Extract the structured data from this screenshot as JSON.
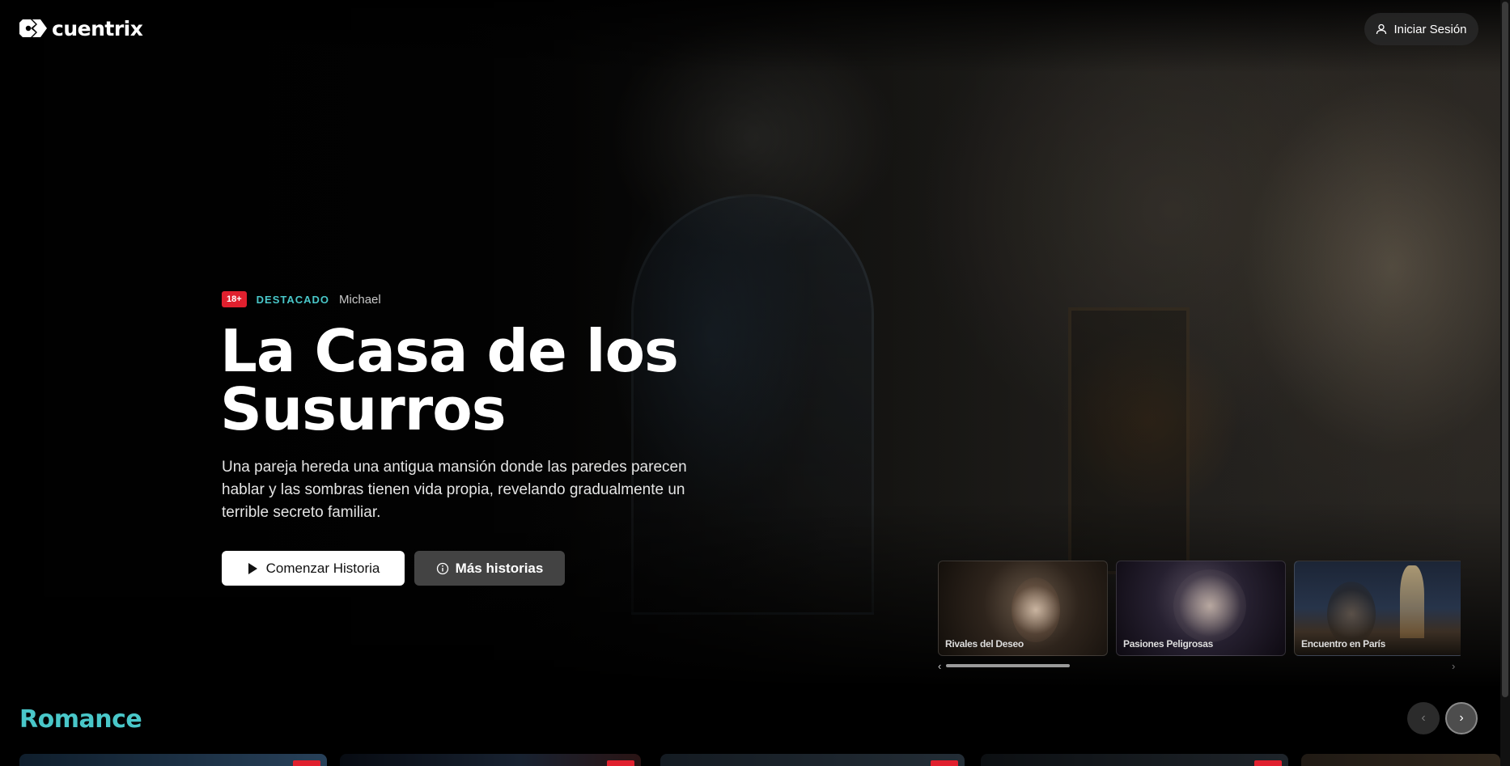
{
  "brand": {
    "name": "cuentrix"
  },
  "header": {
    "login_label": "Iniciar Sesión"
  },
  "hero": {
    "age_rating": "18+",
    "tag": "DESTACADO",
    "author": "Michael",
    "title": "La Casa de los Susurros",
    "description": "Una pareja hereda una antigua mansión donde las paredes parecen hablar y las sombras tienen vida propia, revelando gradualmente un terrible secreto familiar.",
    "primary_button": "Comenzar Historia",
    "secondary_button": "Más historias"
  },
  "mini_carousel": {
    "items": [
      {
        "title": "Rivales del Deseo"
      },
      {
        "title": "Pasiones Peligrosas"
      },
      {
        "title": "Encuentro en París"
      }
    ],
    "scroll_progress": 0.2
  },
  "sections": [
    {
      "title": "Romance",
      "prev_icon": "chevron-left-icon",
      "next_icon": "chevron-right-icon"
    }
  ],
  "colors": {
    "accent": "#49c7c9",
    "badge_red": "#e0202e",
    "background": "#000000"
  }
}
